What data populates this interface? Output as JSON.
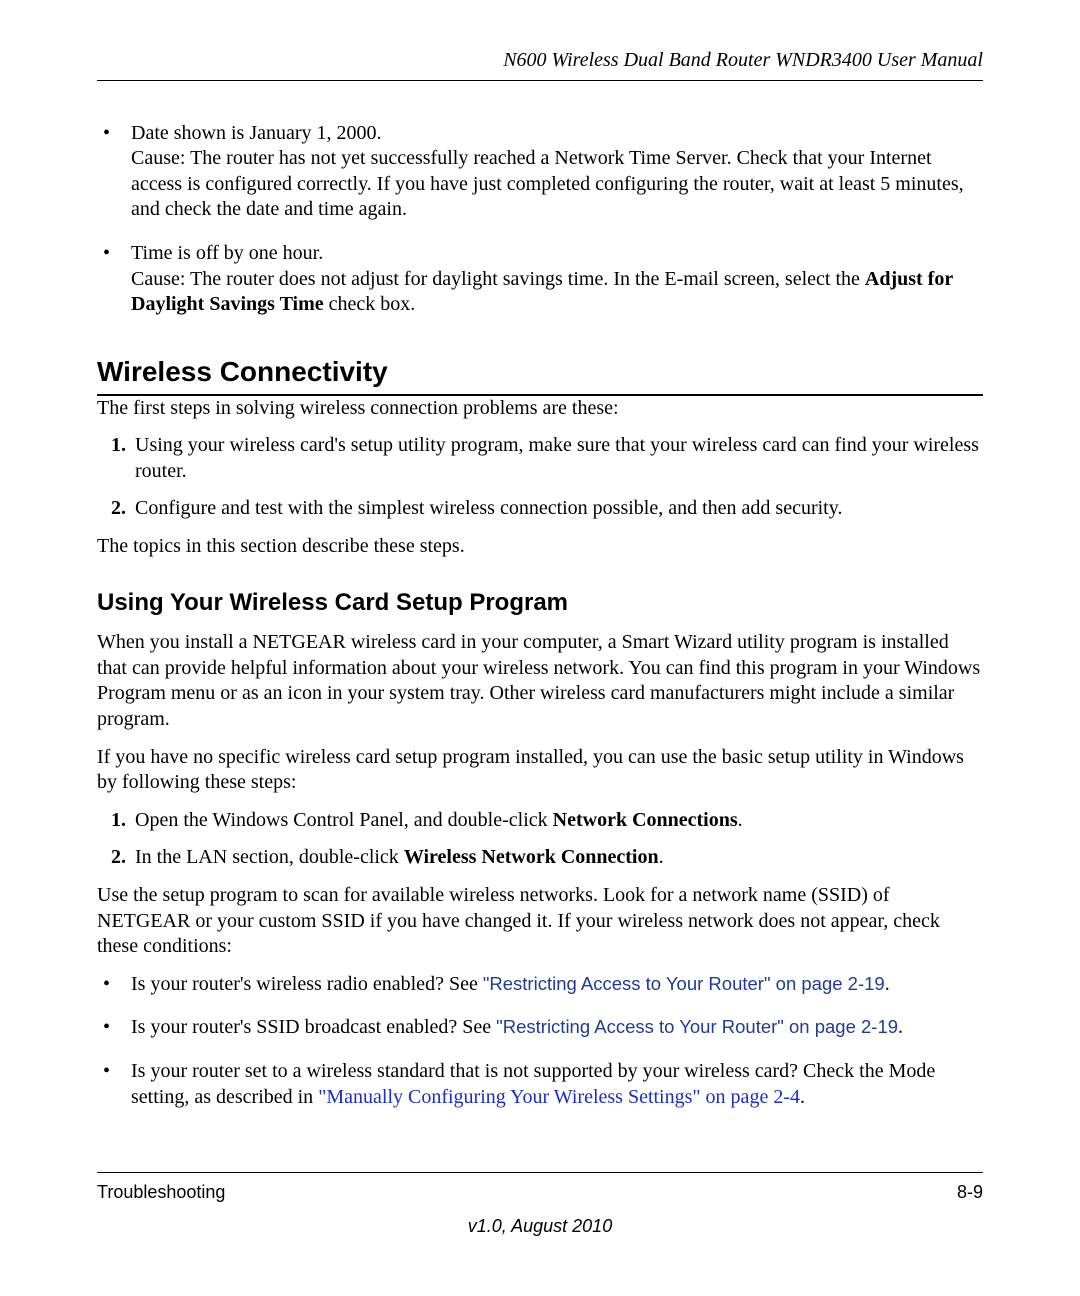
{
  "header": {
    "running_title": "N600 Wireless Dual Band Router WNDR3400 User Manual"
  },
  "time_issues": {
    "item1": {
      "title": "Date shown is January 1, 2000.",
      "cause": "Cause: The router has not yet successfully reached a Network Time Server. Check that your Internet access is configured correctly. If you have just completed configuring the router, wait at least 5 minutes, and check the date and time again."
    },
    "item2": {
      "title": "Time is off by one hour.",
      "cause_pre": "Cause: The router does not adjust for daylight savings time. In the E-mail screen, select the ",
      "cause_bold": "Adjust for Daylight Savings Time",
      "cause_post": " check box."
    }
  },
  "section": {
    "title": "Wireless Connectivity",
    "intro": "The first steps in solving wireless connection problems are these:",
    "steps": {
      "s1": "Using your wireless card's setup utility program, make sure that your wireless card can find your wireless router.",
      "s2": "Configure and test with the simplest wireless connection possible, and then add security."
    },
    "outro": "The topics in this section describe these steps."
  },
  "subsection": {
    "title": "Using Your Wireless Card Setup Program",
    "p1": "When you install a NETGEAR wireless card in your computer, a Smart Wizard utility program is installed that can provide helpful information about your wireless network. You can find this program in your Windows Program menu or as an icon in your system tray. Other wireless card manufacturers might include a similar program.",
    "p2": "If you have no specific wireless card setup program installed, you can use the basic setup utility in Windows by following these steps:",
    "steps": {
      "s1_pre": "Open the Windows Control Panel, and double-click ",
      "s1_bold": "Network Connections",
      "s1_post": ".",
      "s2_pre": "In the LAN section, double-click ",
      "s2_bold": "Wireless Network Connection",
      "s2_post": "."
    },
    "p3": "Use the setup program to scan for available wireless networks. Look for a network name (SSID) of NETGEAR or your custom SSID if you have changed it. If your wireless network does not appear, check these conditions:",
    "conditions": {
      "c1_pre": "Is your router's wireless radio enabled? See ",
      "c1_link": "\"Restricting Access to Your Router\" on page 2-19",
      "c1_post": ".",
      "c2_pre": "Is your router's SSID broadcast enabled? See ",
      "c2_link": "\"Restricting Access to Your Router\" on page 2-19",
      "c2_post": ".",
      "c3_pre": "Is your router set to a wireless standard that is not supported by your wireless card? Check the Mode setting, as described in ",
      "c3_link": "\"Manually Configuring Your Wireless Settings\" on page 2-4",
      "c3_post": "."
    }
  },
  "footer": {
    "section_label": "Troubleshooting",
    "page_number": "8-9",
    "version": "v1.0, August 2010"
  }
}
